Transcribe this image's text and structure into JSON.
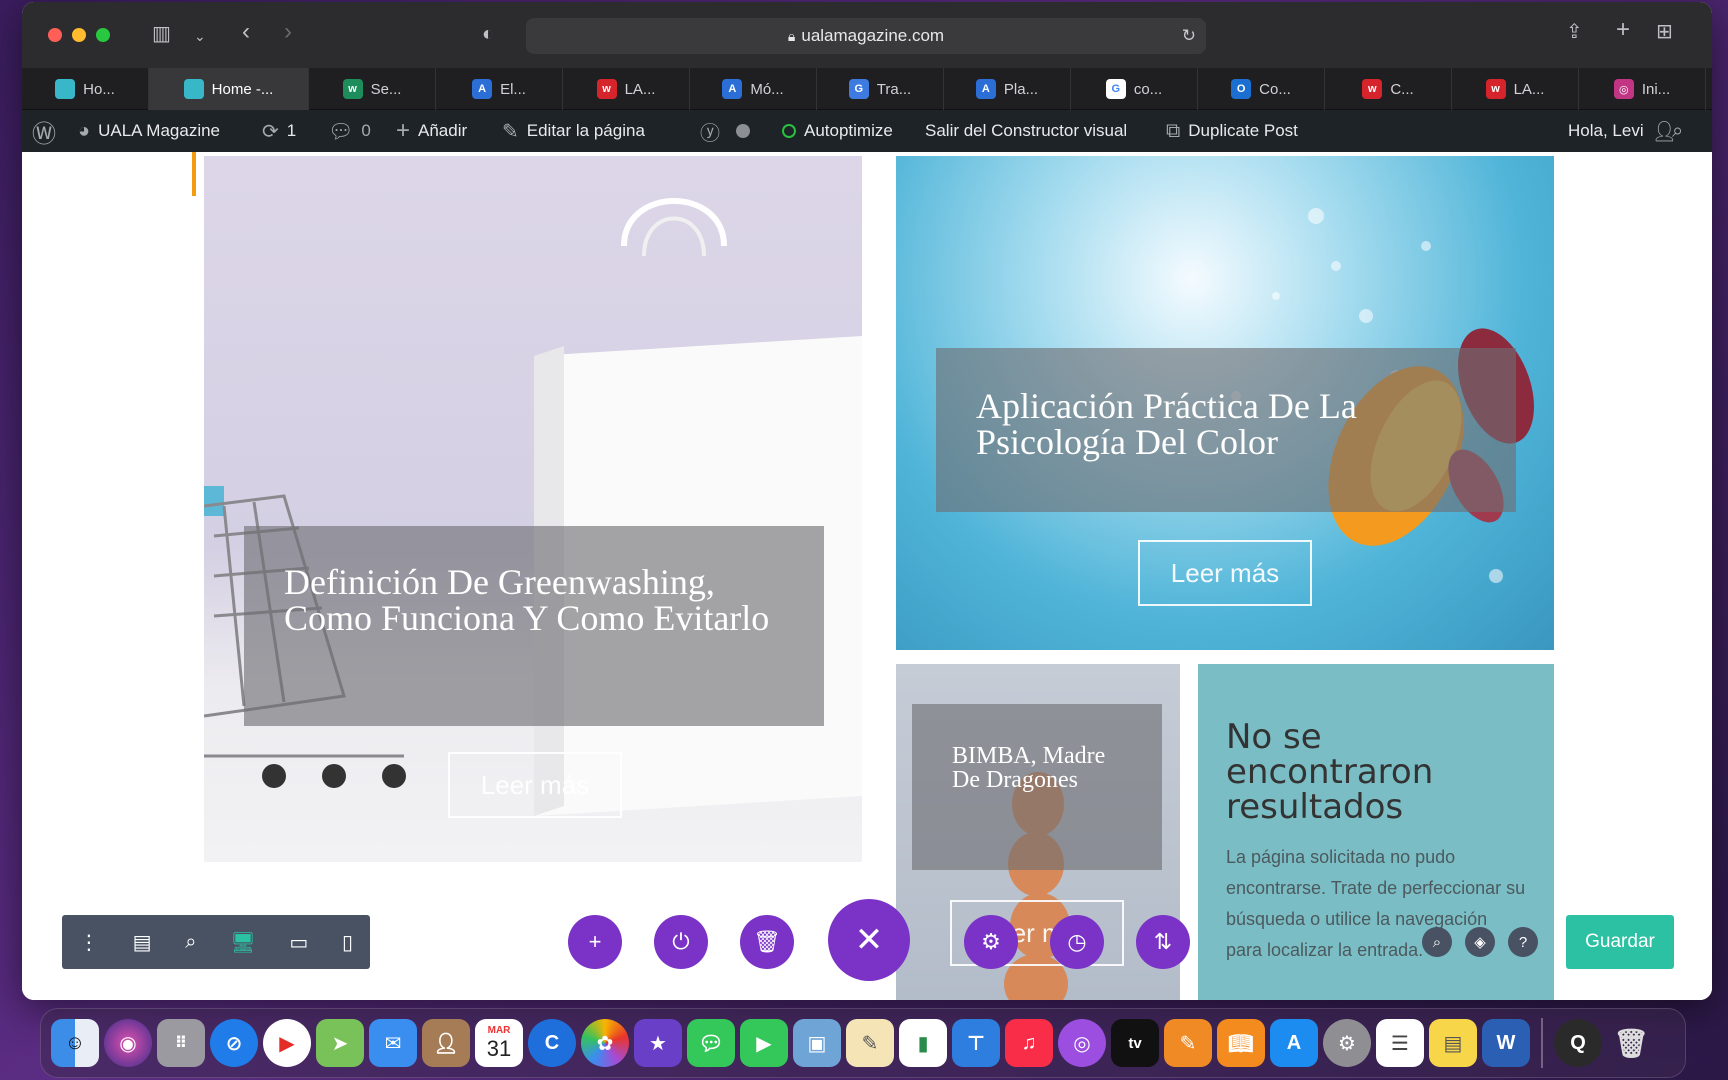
{
  "browser": {
    "url": "ualamagazine.com",
    "tabs": [
      {
        "label": "Ho...",
        "icon": "page-icon",
        "color": "#37b7c8",
        "glyph": ""
      },
      {
        "label": "Home -...",
        "icon": "page-icon",
        "color": "#37b7c8",
        "glyph": "",
        "active": true
      },
      {
        "label": "Se...",
        "icon": "w-icon",
        "color": "#1e8d5c",
        "glyph": "w"
      },
      {
        "label": "El...",
        "icon": "a-icon",
        "color": "#2a6ed6",
        "glyph": "A"
      },
      {
        "label": "LA...",
        "icon": "w-icon",
        "color": "#d6242c",
        "glyph": "w"
      },
      {
        "label": "Mó...",
        "icon": "a-icon",
        "color": "#2a6ed6",
        "glyph": "A"
      },
      {
        "label": "Tra...",
        "icon": "translate-icon",
        "color": "#3d7be0",
        "glyph": "G"
      },
      {
        "label": "Pla...",
        "icon": "a-icon",
        "color": "#2a6ed6",
        "glyph": "A"
      },
      {
        "label": "co...",
        "icon": "google-icon",
        "color": "#ffffff",
        "glyph": "G"
      },
      {
        "label": "Co...",
        "icon": "outlook-icon",
        "color": "#1a6fd1",
        "glyph": "O"
      },
      {
        "label": "C...",
        "icon": "w-icon",
        "color": "#d6242c",
        "glyph": "w"
      },
      {
        "label": "LA...",
        "icon": "w-icon",
        "color": "#d6242c",
        "glyph": "w"
      },
      {
        "label": "Ini...",
        "icon": "instagram-icon",
        "color": "#c13584",
        "glyph": "◎"
      }
    ]
  },
  "adminbar": {
    "site": "UALA Magazine",
    "updates": "1",
    "comments": "0",
    "add": "Añadir",
    "edit": "Editar la página",
    "autoptimize": "Autoptimize",
    "exit_builder": "Salir del Constructor visual",
    "duplicate": "Duplicate Post",
    "greeting": "Hola, Levi"
  },
  "posts": {
    "greenwashing": {
      "title": "Definición De Greenwashing, Como Funciona Y Como Evitarlo",
      "button": "Leer más"
    },
    "color": {
      "title": "Aplicación Práctica De La Psicología Del Color",
      "button": "Leer más"
    },
    "bimba": {
      "title": "BIMBA, Madre De Dragones",
      "button": "Leer más"
    },
    "not_found": {
      "heading": "No se encontraron resultados",
      "text": "La página solicitada no pudo encontrarse. Trate de perfeccionar su búsqueda o utilice la navegación para localizar la entrada."
    }
  },
  "builder": {
    "save_label": "Guardar",
    "accent": "#7b33c7",
    "save_color": "#2dc1a3"
  },
  "dock": {
    "calendar_month": "MAR",
    "calendar_day": "31",
    "tv_label": "tv"
  }
}
